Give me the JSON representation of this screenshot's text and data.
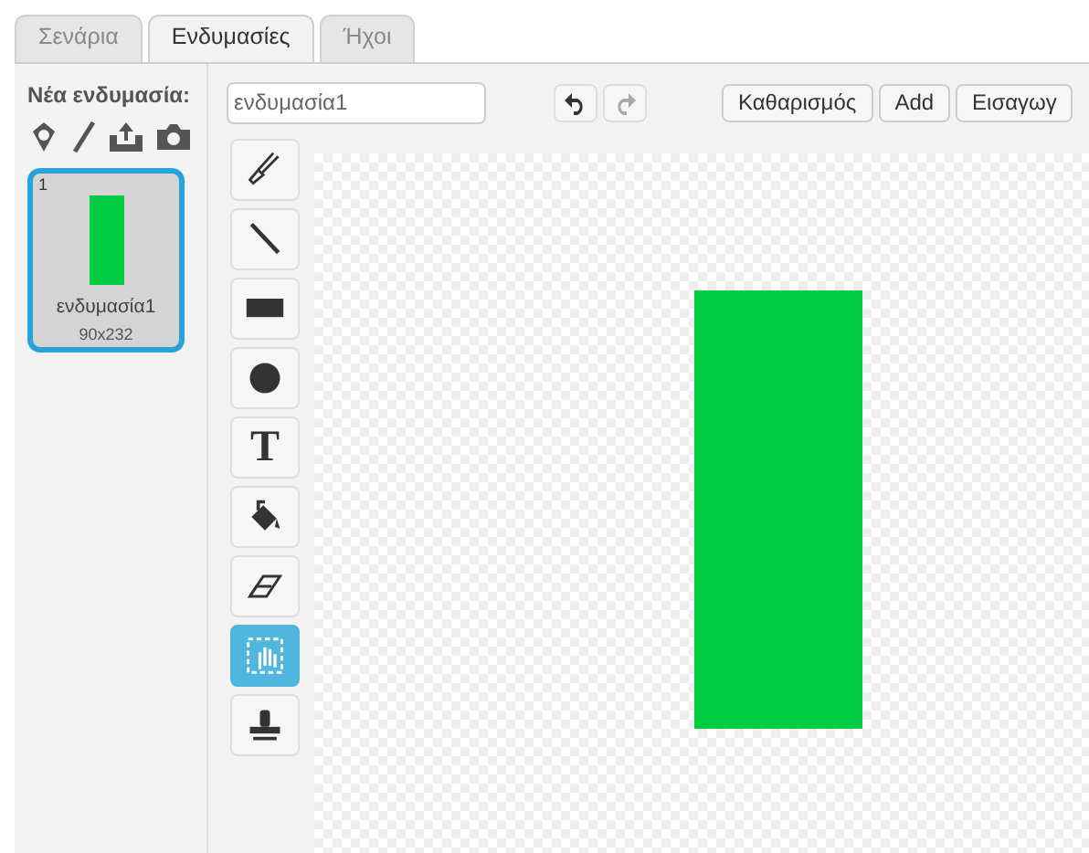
{
  "tabs": [
    {
      "label": "Σενάρια",
      "selected": false
    },
    {
      "label": "Ενδυμασίες",
      "selected": true
    },
    {
      "label": "Ήχοι",
      "selected": false
    }
  ],
  "sidebar": {
    "title": "Νέα ενδυμασία:",
    "costumes": [
      {
        "number": "1",
        "name": "ενδυμασία1",
        "size": "90x232",
        "selected": true
      }
    ]
  },
  "editor": {
    "name_field": "ενδυμασία1",
    "undo_enabled": true,
    "redo_enabled": false,
    "buttons": [
      "Καθαρισμός",
      "Add",
      "Εισαγωγ"
    ],
    "tools": [
      {
        "kind": "brush",
        "selected": false
      },
      {
        "kind": "line",
        "selected": false
      },
      {
        "kind": "rectangle",
        "selected": false
      },
      {
        "kind": "ellipse",
        "selected": false
      },
      {
        "kind": "text",
        "label": "T",
        "selected": false
      },
      {
        "kind": "fill",
        "selected": false
      },
      {
        "kind": "eraser",
        "selected": false
      },
      {
        "kind": "select",
        "selected": true
      },
      {
        "kind": "stamp",
        "selected": false
      }
    ]
  }
}
